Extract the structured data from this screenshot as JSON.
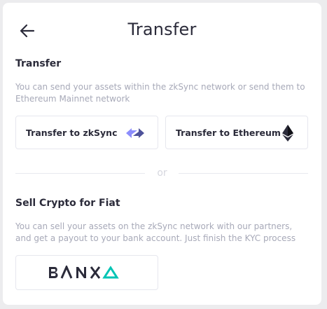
{
  "header": {
    "title": "Transfer",
    "back_icon": "arrow-left-icon"
  },
  "transfer_section": {
    "title": "Transfer",
    "description": "You can send your assets within the zkSync network or send them to Ethereum Mainnet network",
    "options": [
      {
        "label": "Transfer to zkSync",
        "icon": "zksync-icon"
      },
      {
        "label": "Transfer to Ethereum",
        "icon": "ethereum-icon"
      }
    ]
  },
  "divider": {
    "text": "or"
  },
  "fiat_section": {
    "title": "Sell Crypto for Fiat",
    "description": "You can sell your assets on the zkSync network with our partners, and get a payout to your bank account. Just finish the KYC process",
    "partner": {
      "name": "BANXA",
      "icon": "banxa-logo"
    }
  },
  "colors": {
    "text_primary": "#2b2b3a",
    "text_muted": "#a7a9b8",
    "zksync_purple": "#8c8dfc",
    "zksync_dark": "#4e529a",
    "banxa_teal": "#00c4b4"
  }
}
